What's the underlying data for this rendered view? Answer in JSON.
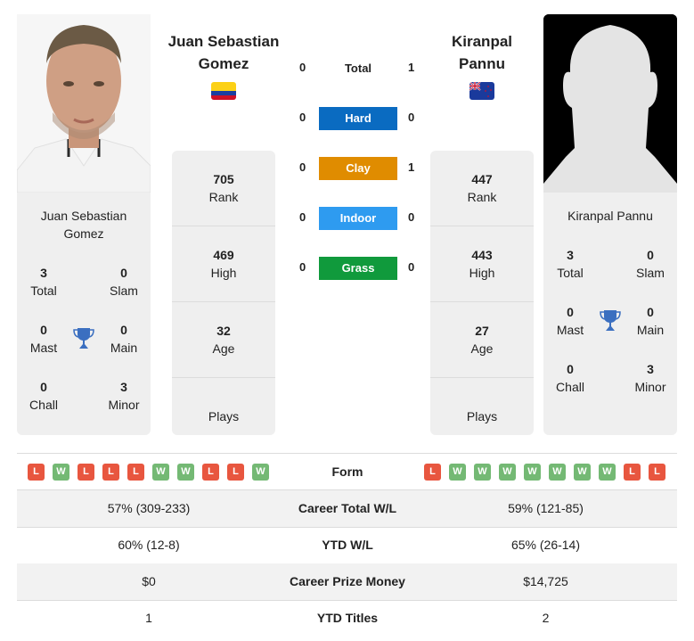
{
  "players": {
    "left": {
      "name_line1": "Juan Sebastian",
      "name_line2": "Gomez",
      "full_name_line1": "Juan Sebastian",
      "full_name_line2": "Gomez",
      "flag": "colombia-flag",
      "stats": {
        "rank": "705",
        "rank_label": "Rank",
        "high": "469",
        "high_label": "High",
        "age": "32",
        "age_label": "Age",
        "plays_label": "Plays"
      },
      "titles": {
        "total": "3",
        "total_label": "Total",
        "slam": "0",
        "slam_label": "Slam",
        "mast": "0",
        "mast_label": "Mast",
        "main": "0",
        "main_label": "Main",
        "chall": "0",
        "chall_label": "Chall",
        "minor": "3",
        "minor_label": "Minor"
      },
      "form": [
        "L",
        "W",
        "L",
        "L",
        "L",
        "W",
        "W",
        "L",
        "L",
        "W"
      ]
    },
    "right": {
      "name_line1": "Kiranpal",
      "name_line2": "Pannu",
      "full_name": "Kiranpal Pannu",
      "flag": "new-zealand-flag",
      "stats": {
        "rank": "447",
        "rank_label": "Rank",
        "high": "443",
        "high_label": "High",
        "age": "27",
        "age_label": "Age",
        "plays_label": "Plays"
      },
      "titles": {
        "total": "3",
        "total_label": "Total",
        "slam": "0",
        "slam_label": "Slam",
        "mast": "0",
        "mast_label": "Mast",
        "main": "0",
        "main_label": "Main",
        "chall": "0",
        "chall_label": "Chall",
        "minor": "3",
        "minor_label": "Minor"
      },
      "form": [
        "L",
        "W",
        "W",
        "W",
        "W",
        "W",
        "W",
        "W",
        "L",
        "L"
      ]
    }
  },
  "h2h": [
    {
      "label": "Total",
      "left": "0",
      "right": "1",
      "color": ""
    },
    {
      "label": "Hard",
      "left": "0",
      "right": "0",
      "color": "#0a6bc1"
    },
    {
      "label": "Clay",
      "left": "0",
      "right": "1",
      "color": "#e08c00"
    },
    {
      "label": "Indoor",
      "left": "0",
      "right": "0",
      "color": "#2e9bf0"
    },
    {
      "label": "Grass",
      "left": "0",
      "right": "0",
      "color": "#109a3c"
    }
  ],
  "form_label": "Form",
  "comparison": [
    {
      "left": "57% (309-233)",
      "label": "Career Total W/L",
      "right": "59% (121-85)"
    },
    {
      "left": "60% (12-8)",
      "label": "YTD W/L",
      "right": "65% (26-14)"
    },
    {
      "left": "$0",
      "label": "Career Prize Money",
      "right": "$14,725"
    },
    {
      "left": "1",
      "label": "YTD Titles",
      "right": "2"
    }
  ],
  "colors": {
    "loss": "#e8563f",
    "win": "#74b974",
    "trophy": "#3b6fc0",
    "card_bg": "#efefef"
  }
}
